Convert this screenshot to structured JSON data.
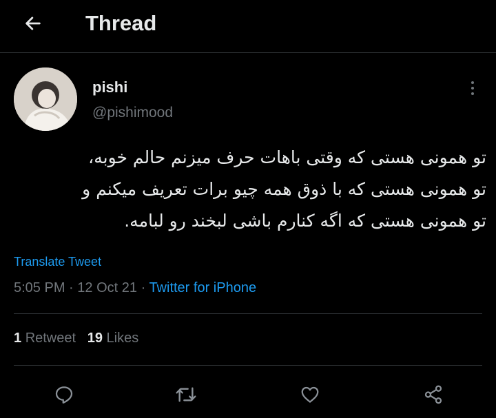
{
  "header": {
    "title": "Thread",
    "back_icon": "arrow-left-icon"
  },
  "tweet": {
    "author": {
      "name": "pishi",
      "handle": "@pishimood",
      "avatar_icon": "profile-avatar"
    },
    "text_lines": [
      "تو همونی هستی که وقتی باهات حرف میزنم حالم خوبه،",
      "تو همونی هستی که با ذوق همه چیو برات تعریف میکنم و",
      "تو همونی هستی که اگه کنارم باشی لبخند رو لبامه."
    ],
    "translate_label": "Translate Tweet",
    "time": "5:05 PM",
    "date": "12 Oct 21",
    "separator": "·",
    "source": "Twitter for iPhone",
    "stats": {
      "retweets_count": "1",
      "retweets_label": "Retweet",
      "likes_count": "19",
      "likes_label": "Likes"
    }
  },
  "actions": [
    {
      "name": "reply",
      "icon": "reply-icon"
    },
    {
      "name": "retweet",
      "icon": "retweet-icon"
    },
    {
      "name": "like",
      "icon": "heart-icon"
    },
    {
      "name": "share",
      "icon": "share-icon"
    }
  ],
  "colors": {
    "background": "#000000",
    "text": "#e7e9ea",
    "secondary": "#71767b",
    "link": "#1d9bf0",
    "divider": "#2f3336"
  }
}
